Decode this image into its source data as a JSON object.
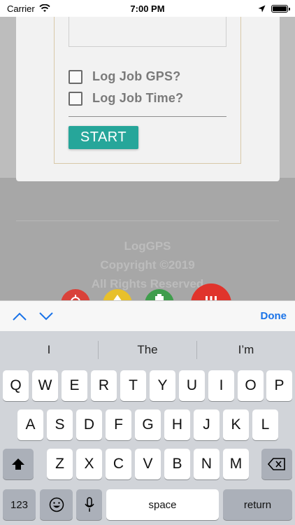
{
  "status_bar": {
    "carrier": "Carrier",
    "time": "7:00 PM"
  },
  "form": {
    "checkbox_gps_label": "Log Job GPS?",
    "checkbox_time_label": "Log Job Time?",
    "start_label": "START"
  },
  "footer": {
    "line1": "LogGPS",
    "line2": "Copyright ©2019",
    "line3": "All Rights Reserved"
  },
  "accessory": {
    "done_label": "Done"
  },
  "keyboard": {
    "suggestions": [
      "I",
      "The",
      "I’m"
    ],
    "row1": [
      "Q",
      "W",
      "E",
      "R",
      "T",
      "Y",
      "U",
      "I",
      "O",
      "P"
    ],
    "row2": [
      "A",
      "S",
      "D",
      "F",
      "G",
      "H",
      "J",
      "K",
      "L"
    ],
    "row3": [
      "Z",
      "X",
      "C",
      "V",
      "B",
      "N",
      "M"
    ],
    "numbers_label": "123",
    "space_label": "space",
    "return_label": "return"
  }
}
